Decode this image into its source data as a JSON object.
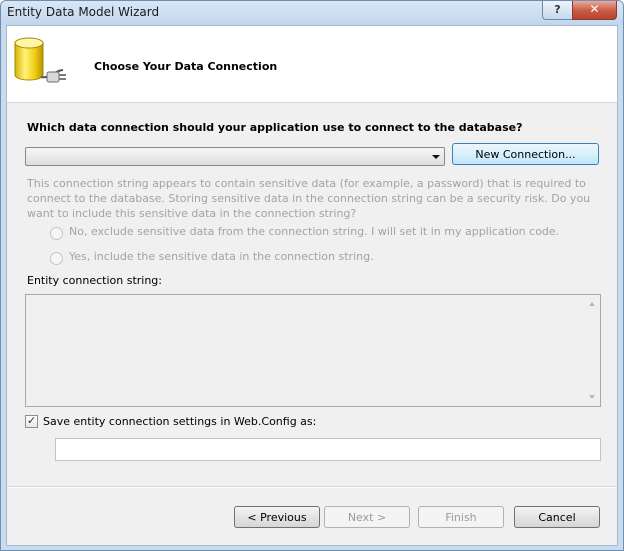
{
  "window": {
    "title": "Entity Data Model Wizard",
    "help_label": "?",
    "close_label": "✕"
  },
  "header": {
    "title": "Choose Your Data Connection"
  },
  "connection": {
    "question": "Which data connection should your application use to connect to the database?",
    "selected": "",
    "new_connection_label": "New Connection..."
  },
  "sensitive": {
    "info": "This connection string appears to contain sensitive data (for example, a password) that is required to connect to the database. Storing sensitive data in the connection string can be a security risk. Do you want to include this sensitive data in the connection string?",
    "option_no": "No, exclude sensitive data from the connection string. I will set it in my application code.",
    "option_yes": "Yes, include the sensitive data in the connection string."
  },
  "entity": {
    "label": "Entity connection string:",
    "value": ""
  },
  "save": {
    "checked": true,
    "label": "Save entity connection settings in Web.Config as:",
    "value": ""
  },
  "footer": {
    "previous_label": "< Previous",
    "next_label": "Next >",
    "finish_label": "Finish",
    "cancel_label": "Cancel"
  },
  "colors": {
    "titlebar": "#c9dcef",
    "disabled_text": "#a3a3a3",
    "focus_border": "#3c7fb1"
  }
}
